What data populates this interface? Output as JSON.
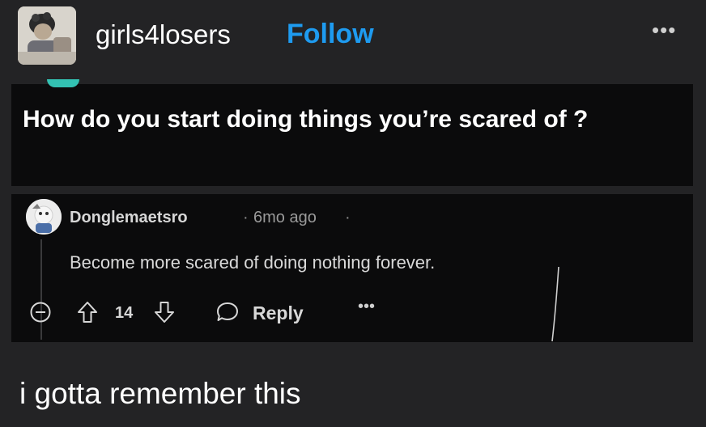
{
  "header": {
    "username": "girls4losers",
    "follow_label": "Follow",
    "more_label": "•••"
  },
  "post": {
    "question": "How do you start doing things you’re scared of ?"
  },
  "comment": {
    "author": "Donglemaetsro",
    "separator": "·",
    "time": "6mo ago",
    "body": "Become more scared of doing nothing forever.",
    "score": "14",
    "reply_label": "Reply",
    "more_label": "•••"
  },
  "caption": {
    "text": "i gotta remember this"
  },
  "colors": {
    "background": "#232325",
    "card": "#0b0b0c",
    "accent": "#1e9bf0",
    "text": "#ffffff"
  }
}
